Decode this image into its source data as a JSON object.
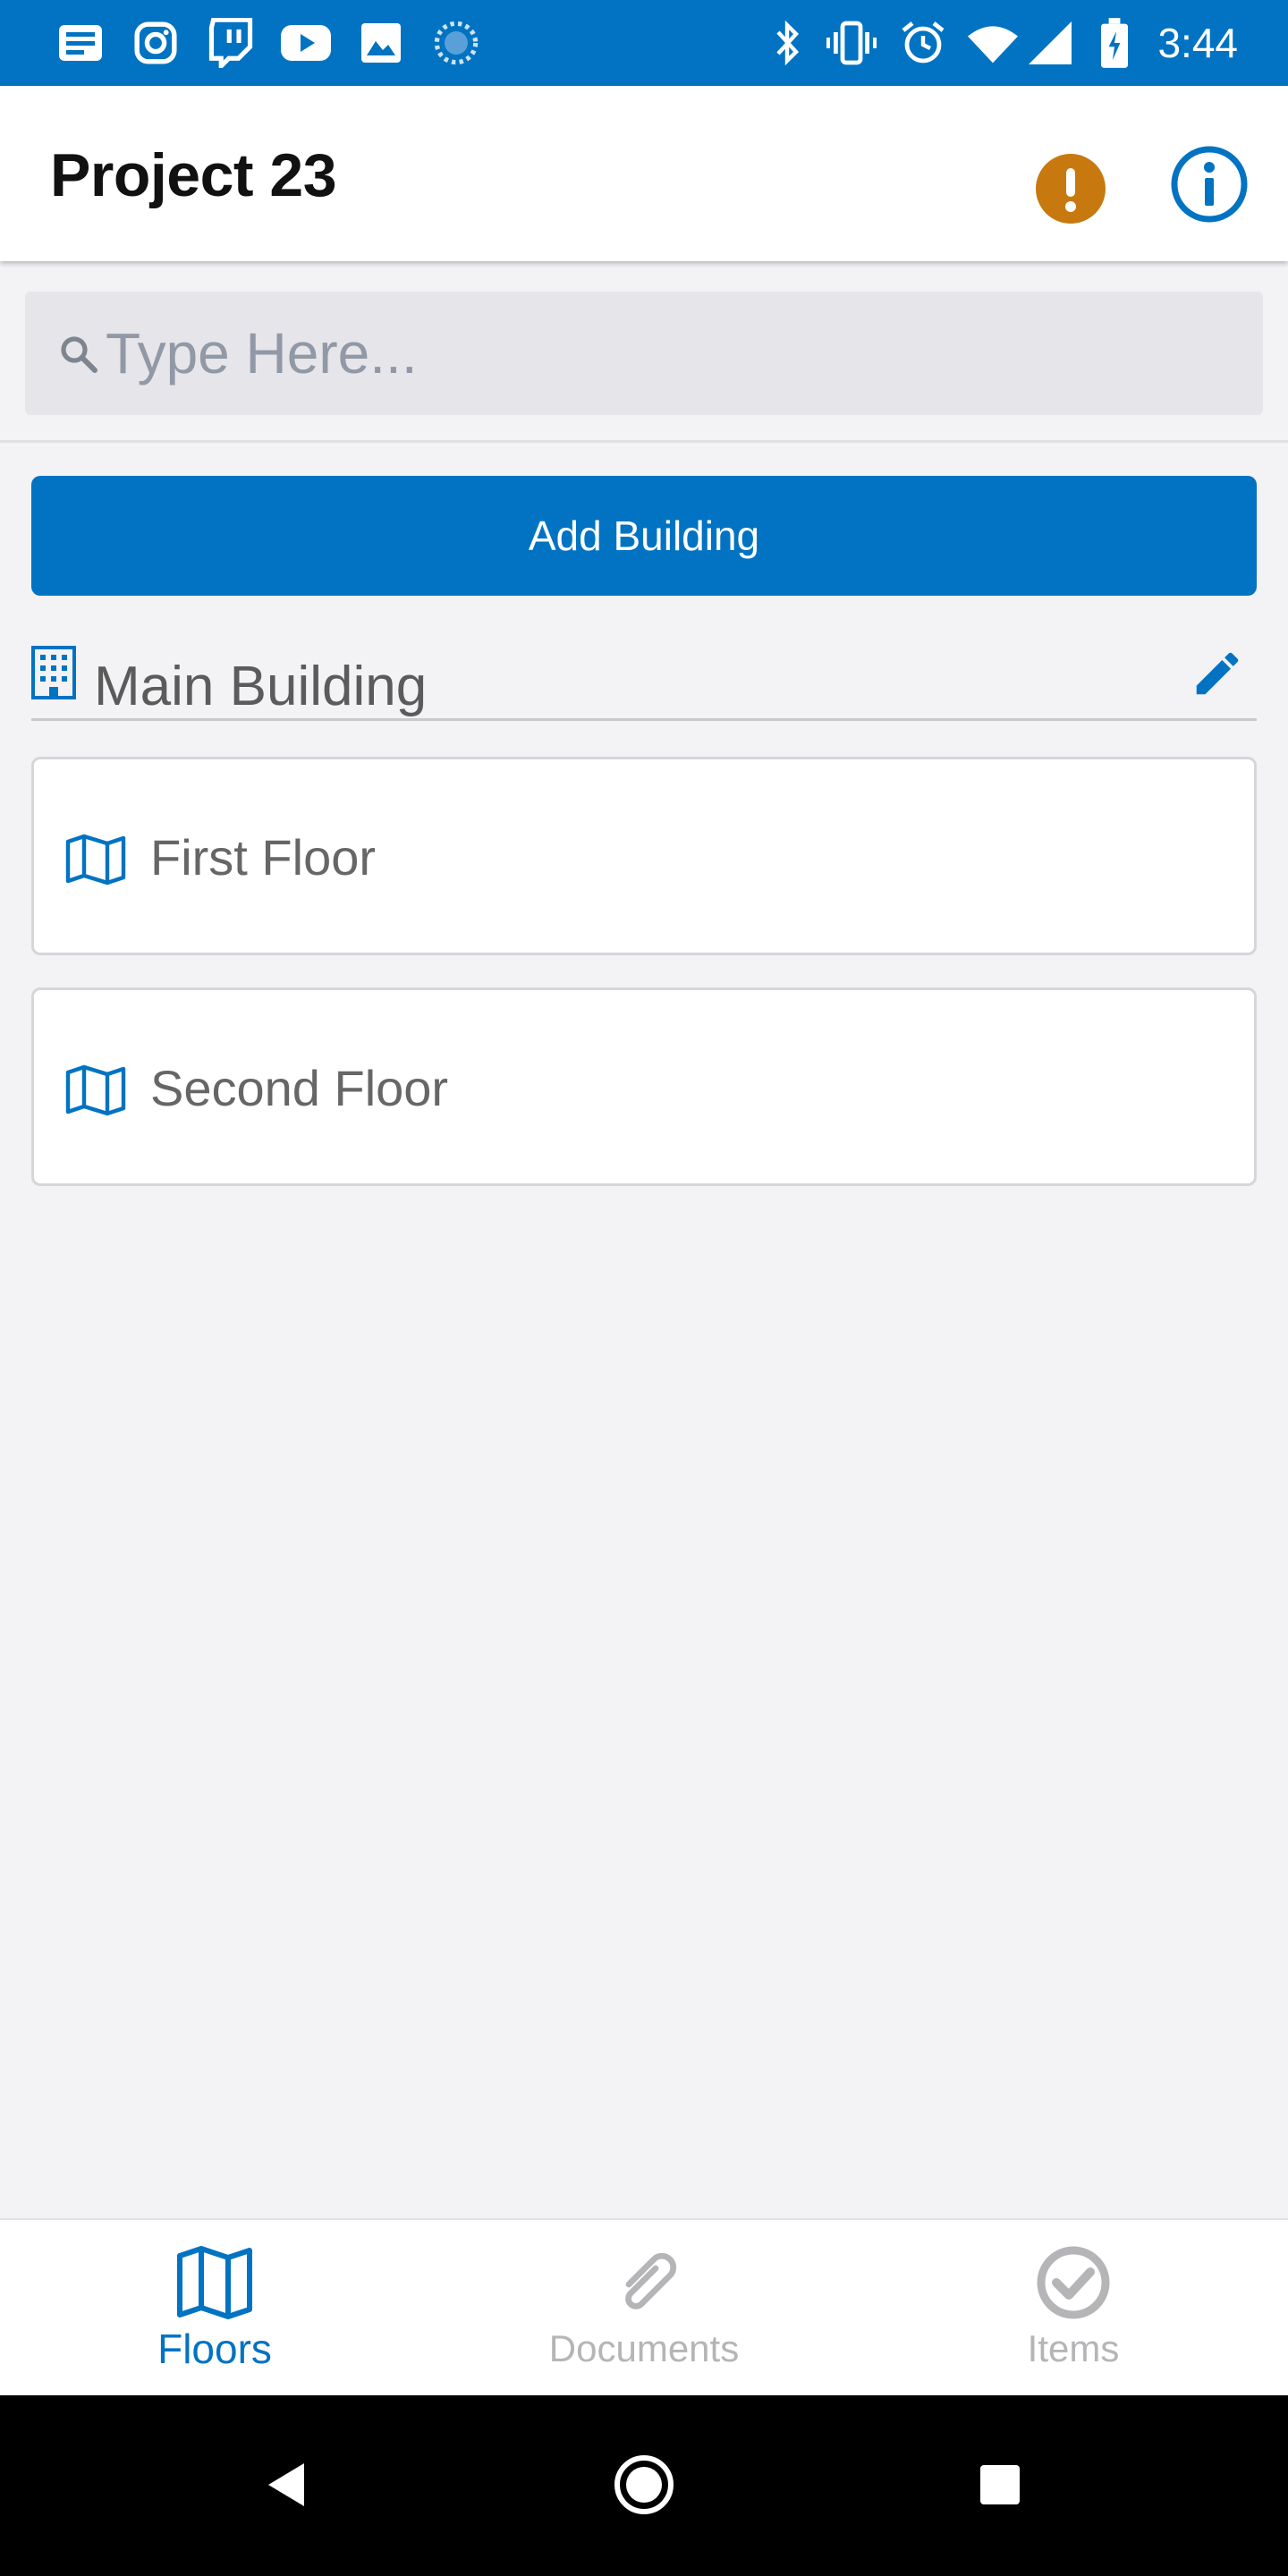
{
  "status_bar": {
    "time": "3:44",
    "left_icons": [
      "news-icon",
      "instagram-icon",
      "twitch-icon",
      "youtube-icon",
      "image-icon",
      "sync-icon"
    ],
    "right_icons": [
      "bluetooth-icon",
      "vibrate-icon",
      "alarm-icon",
      "wifi-icon",
      "signal-icon",
      "battery-icon"
    ],
    "color": "#0173c2"
  },
  "header": {
    "title": "Project 23",
    "warning_color": "#c77910",
    "info_color": "#0173c2"
  },
  "search": {
    "placeholder": "Type Here...",
    "value": ""
  },
  "actions": {
    "add_building_label": "Add Building"
  },
  "building": {
    "name": "Main Building",
    "floors": [
      {
        "label": "First Floor"
      },
      {
        "label": "Second Floor"
      }
    ]
  },
  "bottom_nav": {
    "tabs": [
      {
        "label": "Floors",
        "active": true
      },
      {
        "label": "Documents",
        "active": false
      },
      {
        "label": "Items",
        "active": false
      }
    ]
  },
  "colors": {
    "accent": "#0173c2",
    "inactive": "#b5b5b8",
    "background": "#f3f2f4"
  }
}
